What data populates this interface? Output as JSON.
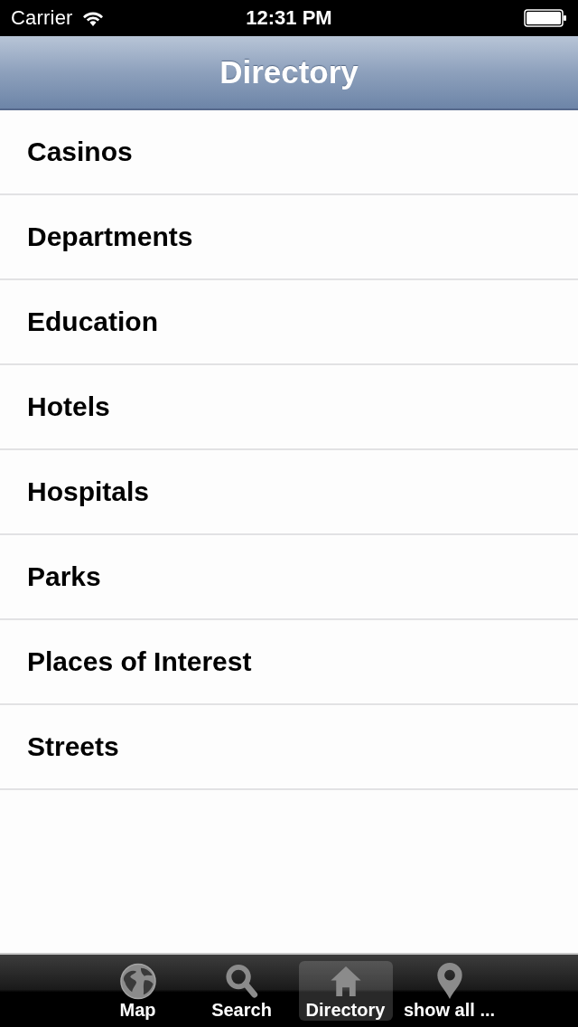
{
  "status_bar": {
    "carrier": "Carrier",
    "time": "12:31 PM"
  },
  "nav_bar": {
    "title": "Directory"
  },
  "list": {
    "items": [
      {
        "label": "Casinos"
      },
      {
        "label": "Departments"
      },
      {
        "label": "Education"
      },
      {
        "label": "Hotels"
      },
      {
        "label": "Hospitals"
      },
      {
        "label": "Parks"
      },
      {
        "label": "Places of Interest"
      },
      {
        "label": "Streets"
      }
    ]
  },
  "tab_bar": {
    "tabs": [
      {
        "label": "Map",
        "kind": "globe",
        "selected": false
      },
      {
        "label": "Search",
        "kind": "search",
        "selected": false
      },
      {
        "label": "Directory",
        "kind": "house",
        "selected": true
      },
      {
        "label": "show all ...",
        "kind": "pin",
        "selected": false
      }
    ]
  }
}
